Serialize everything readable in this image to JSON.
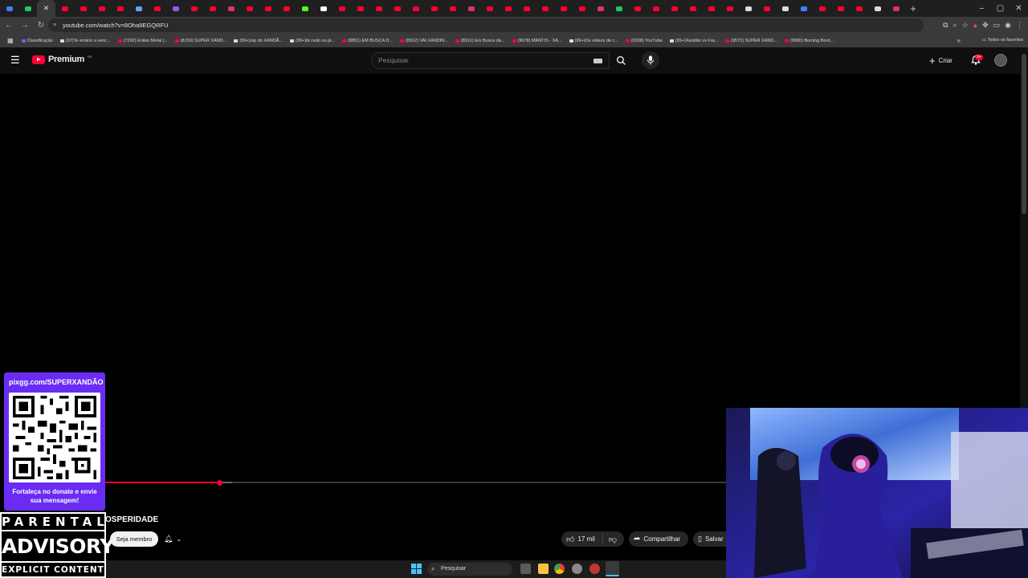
{
  "browser": {
    "active_tab_close": "✕",
    "new_tab": "+",
    "url": "youtube.com/watch?v=8Oha9EGQRFU",
    "window_controls": [
      "–",
      "▢",
      "✕"
    ],
    "bookmarks": [
      "Classificação",
      "(97)Te ensino a venc...",
      "(7292) Enilas Metal |...",
      "(8159) SUPER XAND...",
      "(99+)rap do XANDÃ...",
      "(99+)tá cedo ou já...",
      "(8851) EM BUSCA D...",
      "(8912) VAI XANDIN...",
      "(8912) Em Busca da...",
      "(9078) MANTIS - XA...",
      "(99+)Os vídeos de c...",
      "(9338) YouTube",
      "(99+)Xandão vs Fra...",
      "(9572) SUPER XAND...",
      "(9580) Burning Bord..."
    ],
    "bookmarks_more": "»",
    "all_bookmarks": "Todos os favoritos"
  },
  "youtube": {
    "logo_text": "Premium",
    "logo_country": "BR",
    "search_placeholder": "Pesquisar",
    "create_label": "Criar",
    "notifications_badge": "9+",
    "video_title": "OSPERIDADE",
    "join_label": "Seja membro",
    "like_count": "17 mil",
    "share_label": "Compartilhar",
    "save_label": "Salvar",
    "progress": 0.185,
    "buffered": 0.205
  },
  "overlay": {
    "pix_url": "pixgg.com/SUPERXANDÃO",
    "pix_message": "Fortaleça no donate e envie sua mensagem!",
    "advisory_line1": "PARENTAL",
    "advisory_line2": "ADVISORY",
    "advisory_line3": "EXPLICIT CONTENT"
  },
  "taskbar": {
    "search_placeholder": "Pesquisar"
  },
  "colors": {
    "yt_red": "#ff0033",
    "pix_purple": "#6a2cf2",
    "background": "#0f0f0f"
  }
}
